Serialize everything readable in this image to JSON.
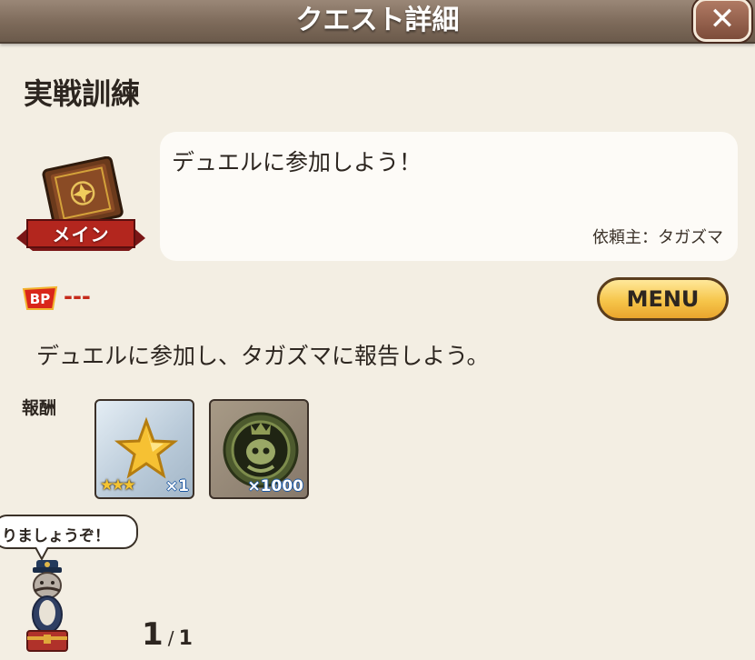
{
  "header": {
    "title": "クエスト詳細",
    "close_label": "✕"
  },
  "quest": {
    "title": "実戦訓練",
    "type_badge": "メイン",
    "summary": "デュエルに参加しよう！",
    "client": "依頼主：タガズマ",
    "bp_value": "---",
    "description": "デュエルに参加し、タガズマに報告しよう。"
  },
  "buttons": {
    "menu": "MENU"
  },
  "rewards": {
    "label": "報酬",
    "items": [
      {
        "icon": "star-icon",
        "rarity": "★★★",
        "quantity": "×1"
      },
      {
        "icon": "medal-icon",
        "quantity": "×1000"
      }
    ]
  },
  "assistant": {
    "speech": "りましょうぞ！"
  },
  "pagination": {
    "current": "1",
    "separator": "/",
    "total": "1"
  }
}
